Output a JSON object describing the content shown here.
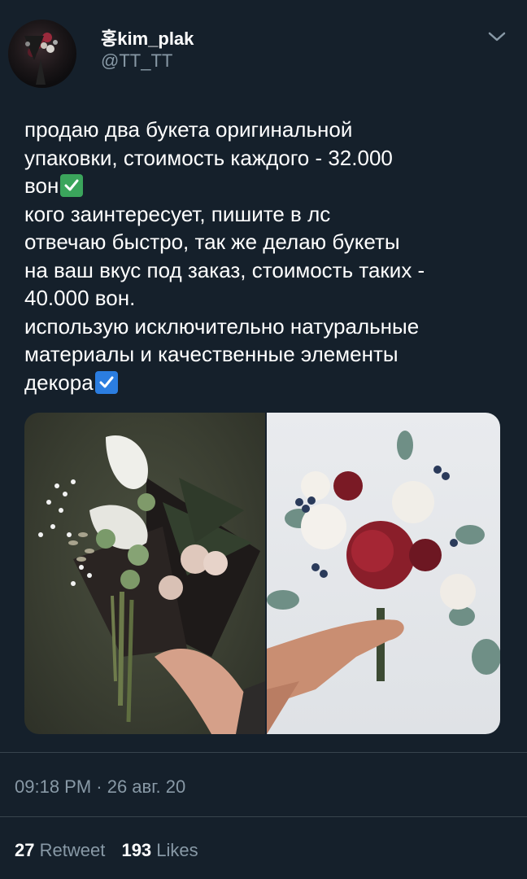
{
  "author": {
    "name": "홍kim_plak",
    "handle": "@TT_TT"
  },
  "tweet": {
    "lines": [
      "продаю два букета оригинальной",
      "упаковки, стоимость каждого - 32.000",
      "вон",
      "кого заинтересует, пишите в лс",
      "отвечаю быстро, так же делаю букеты",
      "на ваш вкус под заказ, стоимость таких -",
      "40.000 вон.",
      "использую исключительно натуральные",
      "материалы и качественные элементы",
      "декора"
    ]
  },
  "icons": {
    "checkmark_green": "white-heavy-check-mark",
    "checkmark_blue": "ballot-box-with-check",
    "menu": "chevron-down-icon"
  },
  "colors": {
    "background": "#15202b",
    "secondary_text": "#8899a6",
    "divider": "#38444d"
  },
  "meta": {
    "timestamp": "09:18 PM · 26 авг. 20"
  },
  "stats": {
    "retweets_count": "27",
    "retweets_label": "Retweet",
    "likes_count": "193",
    "likes_label": "Likes"
  }
}
